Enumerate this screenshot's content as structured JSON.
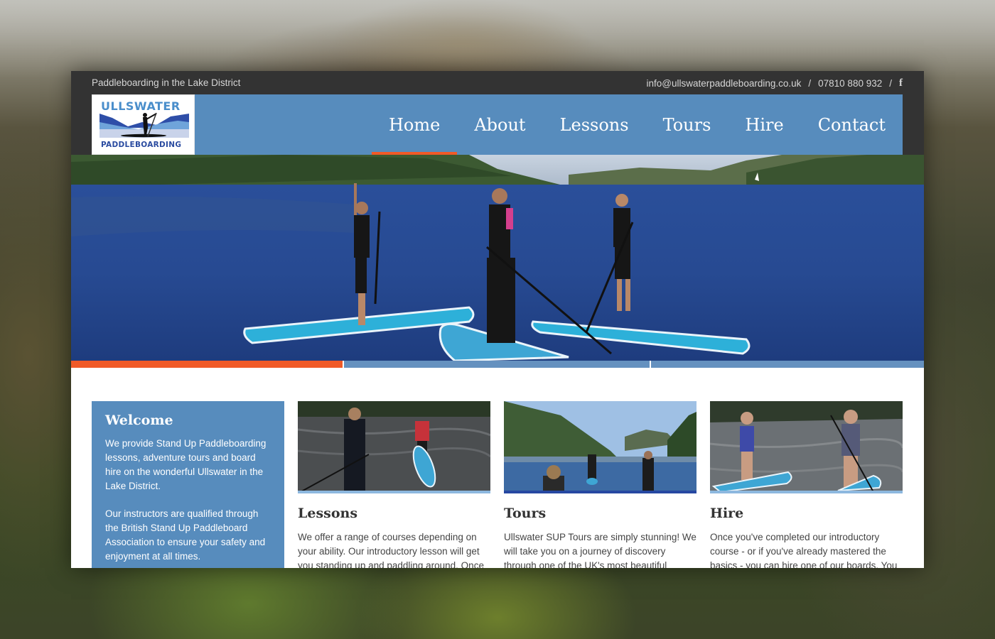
{
  "topbar": {
    "tagline": "Paddleboarding in the Lake District",
    "email": "info@ullswaterpaddleboarding.co.uk",
    "separator": "/",
    "phone": "07810 880 932",
    "social_icon": "f"
  },
  "logo": {
    "line1": "ULLSWATER",
    "line2": "PADDLEBOARDING"
  },
  "nav": {
    "items": [
      {
        "label": "Home",
        "active": true
      },
      {
        "label": "About",
        "active": false
      },
      {
        "label": "Lessons",
        "active": false
      },
      {
        "label": "Tours",
        "active": false
      },
      {
        "label": "Hire",
        "active": false
      },
      {
        "label": "Contact",
        "active": false
      }
    ]
  },
  "slider": {
    "slides": 3,
    "active_index": 0
  },
  "welcome": {
    "title": "Welcome",
    "para1": "We provide Stand Up Paddleboarding lessons, adventure tours and board hire on the wonderful Ullswater in the Lake District.",
    "para2": "Our instructors are qualified through the British Stand Up Paddleboard Association to ensure your safety and enjoyment at all times."
  },
  "cards": [
    {
      "title": "Lessons",
      "text": "We offer a range of courses depending on your ability. Our introductory lesson will get you standing up and paddling around. Once"
    },
    {
      "title": "Tours",
      "text": "Ullswater SUP Tours are simply stunning! We will take you on a journey of discovery through one of the UK's most beautiful"
    },
    {
      "title": "Hire",
      "text": "Once you've completed our introductory course - or if you've already mastered the basics - you can hire one of our boards. You"
    }
  ],
  "colors": {
    "brand_blue": "#578cbd",
    "accent_orange": "#f05a28",
    "topbar_dark": "#333333",
    "slider_inactive": "#6591bf"
  }
}
